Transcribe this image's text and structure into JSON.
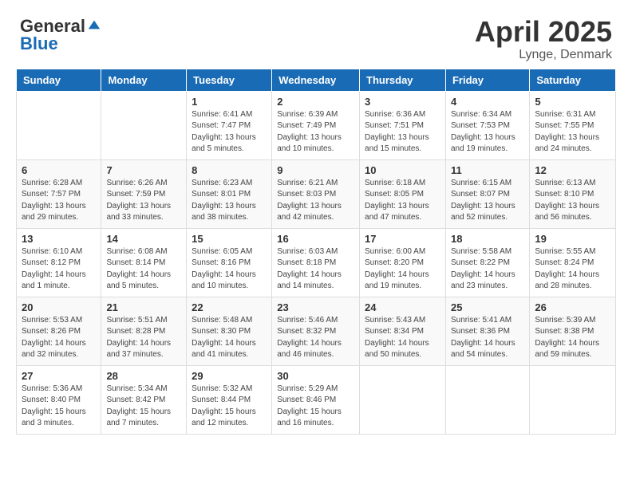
{
  "header": {
    "logo_general": "General",
    "logo_blue": "Blue",
    "month": "April 2025",
    "location": "Lynge, Denmark"
  },
  "days_of_week": [
    "Sunday",
    "Monday",
    "Tuesday",
    "Wednesday",
    "Thursday",
    "Friday",
    "Saturday"
  ],
  "weeks": [
    [
      {
        "day": "",
        "sunrise": "",
        "sunset": "",
        "daylight": ""
      },
      {
        "day": "",
        "sunrise": "",
        "sunset": "",
        "daylight": ""
      },
      {
        "day": "1",
        "sunrise": "Sunrise: 6:41 AM",
        "sunset": "Sunset: 7:47 PM",
        "daylight": "Daylight: 13 hours and 5 minutes."
      },
      {
        "day": "2",
        "sunrise": "Sunrise: 6:39 AM",
        "sunset": "Sunset: 7:49 PM",
        "daylight": "Daylight: 13 hours and 10 minutes."
      },
      {
        "day": "3",
        "sunrise": "Sunrise: 6:36 AM",
        "sunset": "Sunset: 7:51 PM",
        "daylight": "Daylight: 13 hours and 15 minutes."
      },
      {
        "day": "4",
        "sunrise": "Sunrise: 6:34 AM",
        "sunset": "Sunset: 7:53 PM",
        "daylight": "Daylight: 13 hours and 19 minutes."
      },
      {
        "day": "5",
        "sunrise": "Sunrise: 6:31 AM",
        "sunset": "Sunset: 7:55 PM",
        "daylight": "Daylight: 13 hours and 24 minutes."
      }
    ],
    [
      {
        "day": "6",
        "sunrise": "Sunrise: 6:28 AM",
        "sunset": "Sunset: 7:57 PM",
        "daylight": "Daylight: 13 hours and 29 minutes."
      },
      {
        "day": "7",
        "sunrise": "Sunrise: 6:26 AM",
        "sunset": "Sunset: 7:59 PM",
        "daylight": "Daylight: 13 hours and 33 minutes."
      },
      {
        "day": "8",
        "sunrise": "Sunrise: 6:23 AM",
        "sunset": "Sunset: 8:01 PM",
        "daylight": "Daylight: 13 hours and 38 minutes."
      },
      {
        "day": "9",
        "sunrise": "Sunrise: 6:21 AM",
        "sunset": "Sunset: 8:03 PM",
        "daylight": "Daylight: 13 hours and 42 minutes."
      },
      {
        "day": "10",
        "sunrise": "Sunrise: 6:18 AM",
        "sunset": "Sunset: 8:05 PM",
        "daylight": "Daylight: 13 hours and 47 minutes."
      },
      {
        "day": "11",
        "sunrise": "Sunrise: 6:15 AM",
        "sunset": "Sunset: 8:07 PM",
        "daylight": "Daylight: 13 hours and 52 minutes."
      },
      {
        "day": "12",
        "sunrise": "Sunrise: 6:13 AM",
        "sunset": "Sunset: 8:10 PM",
        "daylight": "Daylight: 13 hours and 56 minutes."
      }
    ],
    [
      {
        "day": "13",
        "sunrise": "Sunrise: 6:10 AM",
        "sunset": "Sunset: 8:12 PM",
        "daylight": "Daylight: 14 hours and 1 minute."
      },
      {
        "day": "14",
        "sunrise": "Sunrise: 6:08 AM",
        "sunset": "Sunset: 8:14 PM",
        "daylight": "Daylight: 14 hours and 5 minutes."
      },
      {
        "day": "15",
        "sunrise": "Sunrise: 6:05 AM",
        "sunset": "Sunset: 8:16 PM",
        "daylight": "Daylight: 14 hours and 10 minutes."
      },
      {
        "day": "16",
        "sunrise": "Sunrise: 6:03 AM",
        "sunset": "Sunset: 8:18 PM",
        "daylight": "Daylight: 14 hours and 14 minutes."
      },
      {
        "day": "17",
        "sunrise": "Sunrise: 6:00 AM",
        "sunset": "Sunset: 8:20 PM",
        "daylight": "Daylight: 14 hours and 19 minutes."
      },
      {
        "day": "18",
        "sunrise": "Sunrise: 5:58 AM",
        "sunset": "Sunset: 8:22 PM",
        "daylight": "Daylight: 14 hours and 23 minutes."
      },
      {
        "day": "19",
        "sunrise": "Sunrise: 5:55 AM",
        "sunset": "Sunset: 8:24 PM",
        "daylight": "Daylight: 14 hours and 28 minutes."
      }
    ],
    [
      {
        "day": "20",
        "sunrise": "Sunrise: 5:53 AM",
        "sunset": "Sunset: 8:26 PM",
        "daylight": "Daylight: 14 hours and 32 minutes."
      },
      {
        "day": "21",
        "sunrise": "Sunrise: 5:51 AM",
        "sunset": "Sunset: 8:28 PM",
        "daylight": "Daylight: 14 hours and 37 minutes."
      },
      {
        "day": "22",
        "sunrise": "Sunrise: 5:48 AM",
        "sunset": "Sunset: 8:30 PM",
        "daylight": "Daylight: 14 hours and 41 minutes."
      },
      {
        "day": "23",
        "sunrise": "Sunrise: 5:46 AM",
        "sunset": "Sunset: 8:32 PM",
        "daylight": "Daylight: 14 hours and 46 minutes."
      },
      {
        "day": "24",
        "sunrise": "Sunrise: 5:43 AM",
        "sunset": "Sunset: 8:34 PM",
        "daylight": "Daylight: 14 hours and 50 minutes."
      },
      {
        "day": "25",
        "sunrise": "Sunrise: 5:41 AM",
        "sunset": "Sunset: 8:36 PM",
        "daylight": "Daylight: 14 hours and 54 minutes."
      },
      {
        "day": "26",
        "sunrise": "Sunrise: 5:39 AM",
        "sunset": "Sunset: 8:38 PM",
        "daylight": "Daylight: 14 hours and 59 minutes."
      }
    ],
    [
      {
        "day": "27",
        "sunrise": "Sunrise: 5:36 AM",
        "sunset": "Sunset: 8:40 PM",
        "daylight": "Daylight: 15 hours and 3 minutes."
      },
      {
        "day": "28",
        "sunrise": "Sunrise: 5:34 AM",
        "sunset": "Sunset: 8:42 PM",
        "daylight": "Daylight: 15 hours and 7 minutes."
      },
      {
        "day": "29",
        "sunrise": "Sunrise: 5:32 AM",
        "sunset": "Sunset: 8:44 PM",
        "daylight": "Daylight: 15 hours and 12 minutes."
      },
      {
        "day": "30",
        "sunrise": "Sunrise: 5:29 AM",
        "sunset": "Sunset: 8:46 PM",
        "daylight": "Daylight: 15 hours and 16 minutes."
      },
      {
        "day": "",
        "sunrise": "",
        "sunset": "",
        "daylight": ""
      },
      {
        "day": "",
        "sunrise": "",
        "sunset": "",
        "daylight": ""
      },
      {
        "day": "",
        "sunrise": "",
        "sunset": "",
        "daylight": ""
      }
    ]
  ]
}
